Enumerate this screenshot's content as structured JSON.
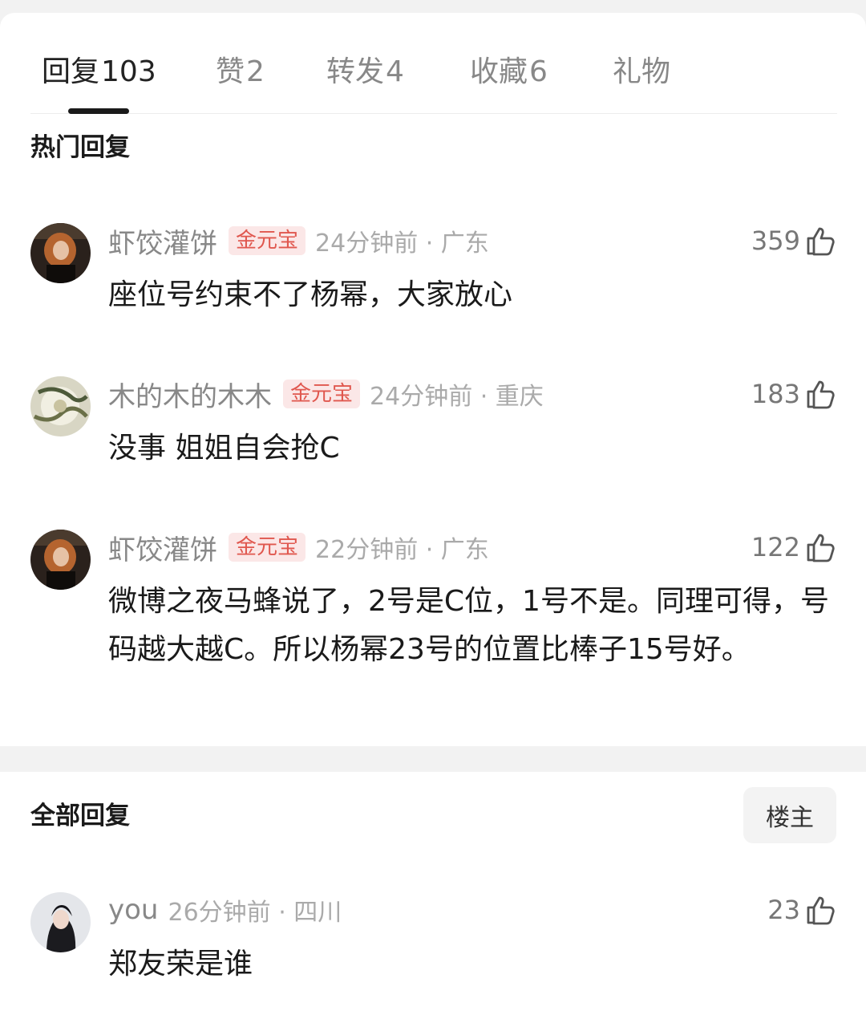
{
  "tabs": [
    {
      "label": "回复",
      "count": "103"
    },
    {
      "label": "赞",
      "count": "2"
    },
    {
      "label": "转发",
      "count": "4"
    },
    {
      "label": "收藏",
      "count": "6"
    },
    {
      "label": "礼物",
      "count": ""
    }
  ],
  "hot_section": {
    "title": "热门回复"
  },
  "hot_comments": [
    {
      "username": "虾饺灌饼",
      "badge": "金元宝",
      "time": "24分钟前 · 广东",
      "likes": "359",
      "text": "座位号约束不了杨幂，大家放心"
    },
    {
      "username": "木的木的木木",
      "badge": "金元宝",
      "time": "24分钟前 · 重庆",
      "likes": "183",
      "text": "没事 姐姐自会抢C"
    },
    {
      "username": "虾饺灌饼",
      "badge": "金元宝",
      "time": "22分钟前 · 广东",
      "likes": "122",
      "text": "微博之夜马蜂说了，2号是C位，1号不是。同理可得，号码越大越C。所以杨幂23号的位置比棒子15号好。"
    }
  ],
  "all_section": {
    "title": "全部回复",
    "owner_button": "楼主"
  },
  "all_comments": [
    {
      "username": "you",
      "time": "26分钟前 · 四川",
      "likes": "23",
      "text": "郑友荣是谁"
    }
  ],
  "colors": {
    "badge_bg": "#fbe7e7",
    "badge_text": "#e0574e",
    "active_tab": "#222222",
    "inactive_tab": "#888888"
  },
  "icons": {
    "like": "thumbs-up-icon"
  }
}
